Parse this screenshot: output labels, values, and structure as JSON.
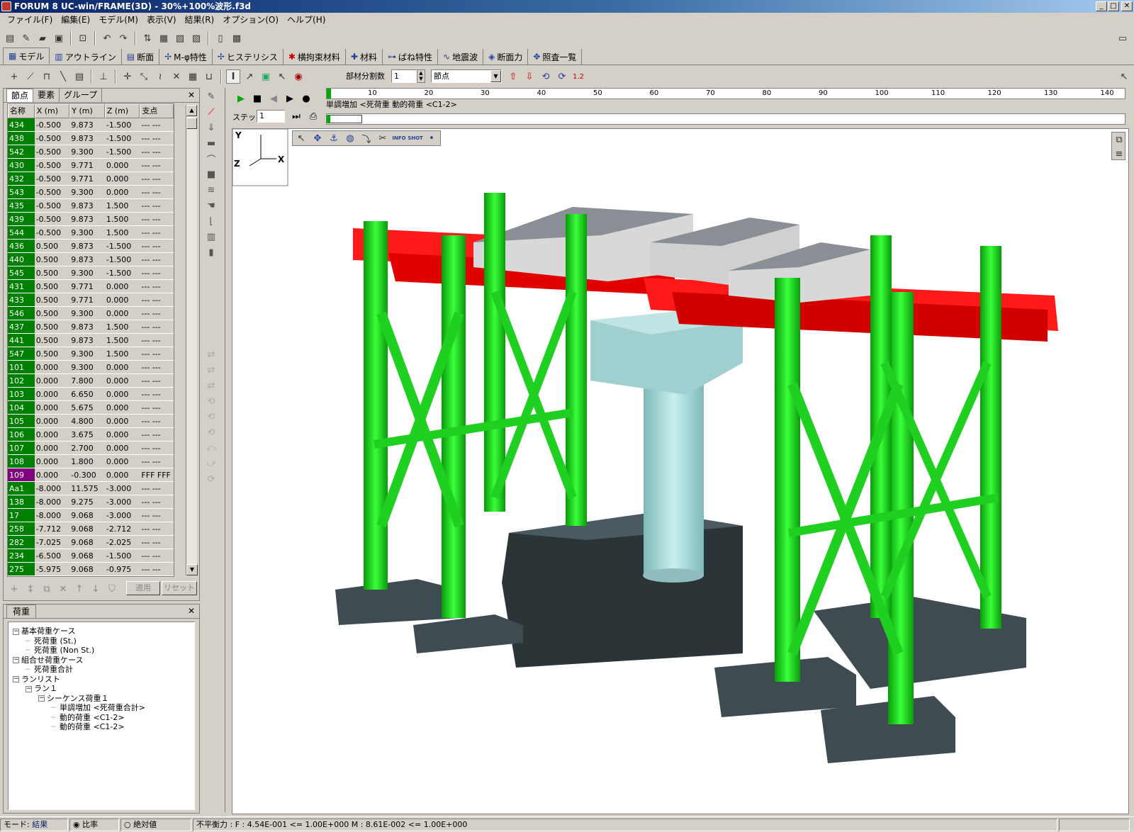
{
  "window": {
    "title": "FORUM 8  UC-win/FRAME(3D) - 30%+100%波形.f3d",
    "min": "_",
    "max": "□",
    "close": "✕"
  },
  "menu": [
    "ファイル(F)",
    "編集(E)",
    "モデル(M)",
    "表示(V)",
    "結果(R)",
    "オプション(O)",
    "ヘルプ(H)"
  ],
  "main_tabs": [
    "モデル",
    "アウトライン",
    "断面",
    "M-φ特性",
    "ヒステリシス",
    "横拘束材料",
    "材料",
    "ばね特性",
    "地震波",
    "断面力",
    "照査一覧"
  ],
  "division": {
    "label": "部材分割数",
    "value": "1",
    "select_value": "節点"
  },
  "left_panel": {
    "tabs": [
      "節点",
      "要素",
      "グループ"
    ],
    "close": "✕",
    "columns": [
      "名称",
      "X (m)",
      "Y (m)",
      "Z (m)",
      "支点"
    ],
    "rows": [
      [
        "434",
        "-0.500",
        "9.873",
        "-1.500",
        "--- ---"
      ],
      [
        "438",
        "-0.500",
        "9.873",
        "-1.500",
        "--- ---"
      ],
      [
        "542",
        "-0.500",
        "9.300",
        "-1.500",
        "--- ---"
      ],
      [
        "430",
        "-0.500",
        "9.771",
        "0.000",
        "--- ---"
      ],
      [
        "432",
        "-0.500",
        "9.771",
        "0.000",
        "--- ---"
      ],
      [
        "543",
        "-0.500",
        "9.300",
        "0.000",
        "--- ---"
      ],
      [
        "435",
        "-0.500",
        "9.873",
        "1.500",
        "--- ---"
      ],
      [
        "439",
        "-0.500",
        "9.873",
        "1.500",
        "--- ---"
      ],
      [
        "544",
        "-0.500",
        "9.300",
        "1.500",
        "--- ---"
      ],
      [
        "436",
        "0.500",
        "9.873",
        "-1.500",
        "--- ---"
      ],
      [
        "440",
        "0.500",
        "9.873",
        "-1.500",
        "--- ---"
      ],
      [
        "545",
        "0.500",
        "9.300",
        "-1.500",
        "--- ---"
      ],
      [
        "431",
        "0.500",
        "9.771",
        "0.000",
        "--- ---"
      ],
      [
        "433",
        "0.500",
        "9.771",
        "0.000",
        "--- ---"
      ],
      [
        "546",
        "0.500",
        "9.300",
        "0.000",
        "--- ---"
      ],
      [
        "437",
        "0.500",
        "9.873",
        "1.500",
        "--- ---"
      ],
      [
        "441",
        "0.500",
        "9.873",
        "1.500",
        "--- ---"
      ],
      [
        "547",
        "0.500",
        "9.300",
        "1.500",
        "--- ---"
      ],
      [
        "101",
        "0.000",
        "9.300",
        "0.000",
        "--- ---"
      ],
      [
        "102",
        "0.000",
        "7.800",
        "0.000",
        "--- ---"
      ],
      [
        "103",
        "0.000",
        "6.650",
        "0.000",
        "--- ---"
      ],
      [
        "104",
        "0.000",
        "5.675",
        "0.000",
        "--- ---"
      ],
      [
        "105",
        "0.000",
        "4.800",
        "0.000",
        "--- ---"
      ],
      [
        "106",
        "0.000",
        "3.675",
        "0.000",
        "--- ---"
      ],
      [
        "107",
        "0.000",
        "2.700",
        "0.000",
        "--- ---"
      ],
      [
        "108",
        "0.000",
        "1.800",
        "0.000",
        "--- ---"
      ],
      [
        "109",
        "0.000",
        "-0.300",
        "0.000",
        "FFF FFF"
      ],
      [
        "Aa1",
        "-8.000",
        "11.575",
        "-3.000",
        "--- ---"
      ],
      [
        "138",
        "-8.000",
        "9.275",
        "-3.000",
        "--- ---"
      ],
      [
        "17",
        "-8.000",
        "9.068",
        "-3.000",
        "--- ---"
      ],
      [
        "258",
        "-7.712",
        "9.068",
        "-2.712",
        "--- ---"
      ],
      [
        "282",
        "-7.025",
        "9.068",
        "-2.025",
        "--- ---"
      ],
      [
        "234",
        "-6.500",
        "9.068",
        "-1.500",
        "--- ---"
      ],
      [
        "275",
        "-5.975",
        "9.068",
        "-0.975",
        "--- ---"
      ]
    ],
    "apply_button": "適用",
    "reset_button": "リセット"
  },
  "load_panel": {
    "tab": "荷重",
    "close": "✕",
    "tree": [
      {
        "text": "基本荷重ケース",
        "level": 0,
        "box": "⊟"
      },
      {
        "text": "死荷重 (St.)",
        "level": 1,
        "box": ""
      },
      {
        "text": "死荷重 (Non St.)",
        "level": 1,
        "box": ""
      },
      {
        "text": "組合せ荷重ケース",
        "level": 0,
        "box": "⊟"
      },
      {
        "text": "死荷重合計",
        "level": 1,
        "box": ""
      },
      {
        "text": "ランリスト",
        "level": 0,
        "box": "⊟"
      },
      {
        "text": "ラン１",
        "level": 1,
        "box": "⊟"
      },
      {
        "text": "シーケンス荷重１",
        "level": 2,
        "box": "⊟"
      },
      {
        "text": "単調増加 <死荷重合計>",
        "level": 3,
        "box": ""
      },
      {
        "text": "動的荷重 <C1-2>",
        "level": 3,
        "box": ""
      },
      {
        "text": "動的荷重 <C1-2>",
        "level": 3,
        "box": ""
      }
    ]
  },
  "playback": {
    "step_label": "ステップ",
    "step_value": "1",
    "current_load": "単調増加 <死荷重 動的荷重 <C1-2>",
    "ruler_ticks": [
      "10",
      "20",
      "30",
      "40",
      "50",
      "60",
      "70",
      "80",
      "90",
      "100",
      "110",
      "120",
      "130",
      "140"
    ]
  },
  "axes": {
    "y": "Y",
    "z": "Z",
    "x": "X"
  },
  "view_tools": {
    "info": "INFO",
    "shot": "SHOT"
  },
  "status": {
    "mode_label": "モード:",
    "mode_value": "結果",
    "radio_ratio": "比率",
    "radio_abs": "絶対値",
    "message": "不平衡力 : F : 4.54E-001 <= 1.00E+000 M : 8.61E-002 <= 1.00E+000"
  },
  "colors": {
    "pier": "#00e400",
    "girder": "#ff1a1a",
    "footing": "#3e4c52",
    "block": "#c8c8c8",
    "column": "#a8d8d8"
  }
}
